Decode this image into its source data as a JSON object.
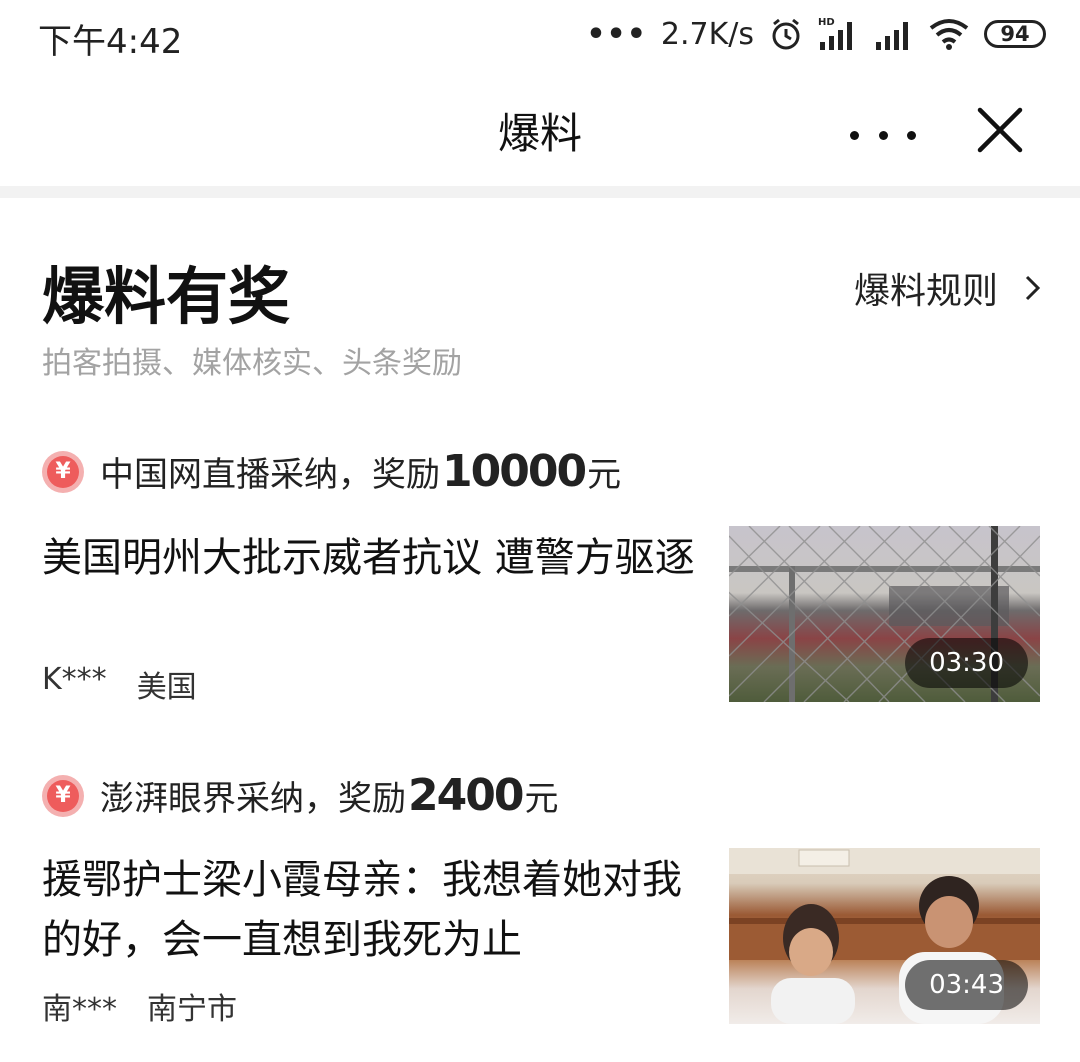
{
  "status_bar": {
    "time": "下午4:42",
    "network_speed": "2.7K/s",
    "battery": "94",
    "signal_tag": "HD"
  },
  "title_bar": {
    "title": "爆料",
    "icons": [
      "more-icon",
      "close-icon"
    ]
  },
  "header": {
    "heading": "爆料有奖",
    "rules_link": "爆料规则",
    "subtitle": "拍客拍摄、媒体核实、头条奖励"
  },
  "items": [
    {
      "reward_prefix": "中国网直播采纳，奖励",
      "reward_amount": "10000",
      "reward_unit": "元",
      "headline": "美国明州大批示威者抗议 遭警方驱逐",
      "author": "K***",
      "location": "美国",
      "duration": "03:30"
    },
    {
      "reward_prefix": "澎湃眼界采纳，奖励",
      "reward_amount": "2400",
      "reward_unit": "元",
      "headline": "援鄂护士梁小霞母亲：我想着她对我的好，会一直想到我死为止",
      "author": "南***",
      "location": "南宁市",
      "duration": "03:43"
    }
  ],
  "colors": {
    "yen_icon": "#ee5c5c",
    "subtitle": "#a3a3a3",
    "divider": "#f2f2f2"
  }
}
